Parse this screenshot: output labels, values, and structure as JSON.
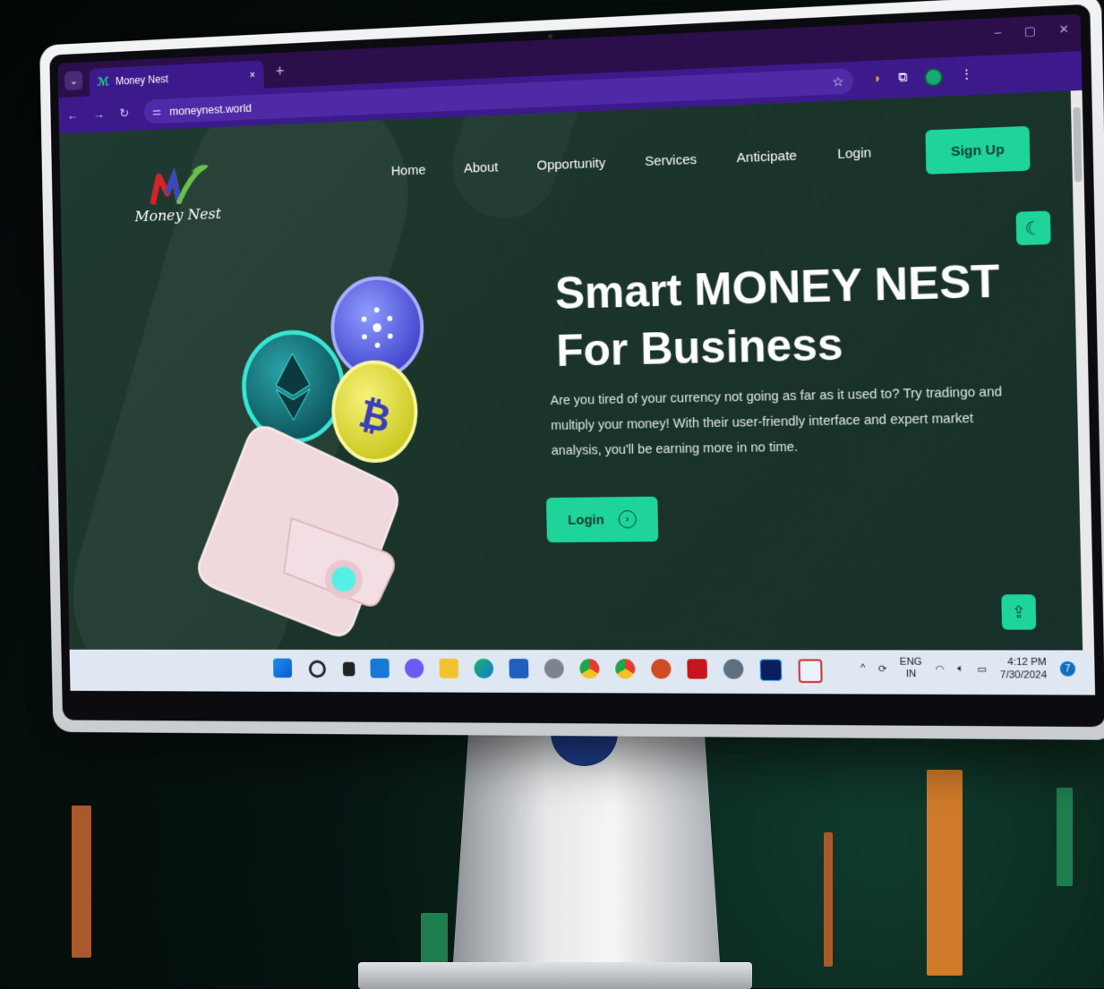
{
  "browser": {
    "tab_title": "Money Nest",
    "url": "moneynest.world",
    "close_glyph": "×",
    "new_tab_glyph": "+",
    "window_controls": [
      "–",
      "▢",
      "✕"
    ]
  },
  "site": {
    "logo_text": "Money Nest",
    "nav": [
      "Home",
      "About",
      "Opportunity",
      "Services",
      "Anticipate",
      "Login"
    ],
    "signup_label": "Sign Up",
    "hero_title_line1": "Smart MONEY NEST",
    "hero_title_line2": "For Business",
    "hero_description": "Are you tired of your currency not going as far as it used to? Try tradingo and multiply your money! With their user-friendly interface and expert market analysis, you'll be earning more in no time.",
    "login_button": "Login",
    "accent_color": "#1fd49a",
    "background_color": "#1f3a30"
  },
  "taskbar": {
    "icons": [
      "windows-start",
      "search",
      "task-view",
      "widgets",
      "chat",
      "file-explorer",
      "edge",
      "store",
      "media",
      "chrome",
      "chrome-profile",
      "powerpoint",
      "acrobat",
      "settings",
      "photoshop",
      "snipping-tool"
    ],
    "lang_line1": "ENG",
    "lang_line2": "IN",
    "time": "4:12 PM",
    "date": "7/30/2024",
    "notification_count": "7"
  }
}
